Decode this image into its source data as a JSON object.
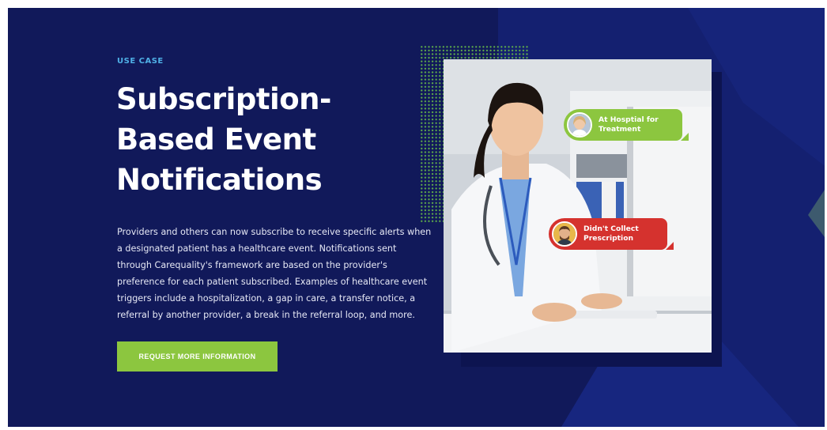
{
  "section": {
    "eyebrow": "USE CASE",
    "headline": "Subscription-Based Event Notifications",
    "body": "Providers and others can now subscribe to receive specific alerts when a designated patient has a healthcare event. Notifications sent through Carequality's framework are based on the provider's preference for each patient subscribed. Examples of healthcare event triggers include a hospitalization, a gap in care, a transfer notice, a referral by another provider, a break in the referral loop, and more.",
    "cta_label": "REQUEST MORE INFORMATION"
  },
  "notifications": [
    {
      "label": "At Hosptial for Treatment",
      "color": "#8cc63f",
      "icon": "patient-avatar-icon"
    },
    {
      "label": "Didn't Collect Prescription",
      "color": "#d5322e",
      "icon": "patient-avatar-icon"
    }
  ],
  "colors": {
    "background": "#11195a",
    "accent_green": "#8cc63f",
    "accent_red": "#d5322e",
    "eyebrow": "#4fb0e6"
  }
}
